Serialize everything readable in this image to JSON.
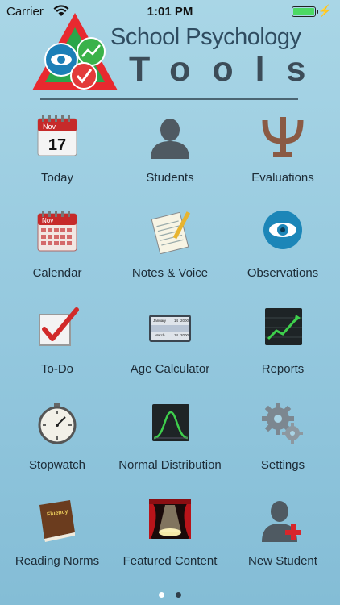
{
  "status_bar": {
    "carrier": "Carrier",
    "time": "1:01 PM",
    "battery_level": 1.0
  },
  "header": {
    "title_line1": "School Psychology",
    "title_line2": "Tools"
  },
  "apps": [
    {
      "label": "Today",
      "icon": "calendar-today-icon",
      "badge_month": "Nov",
      "badge_day": "17"
    },
    {
      "label": "Students",
      "icon": "person-silhouette-icon"
    },
    {
      "label": "Evaluations",
      "icon": "psi-symbol-icon"
    },
    {
      "label": "Calendar",
      "icon": "calendar-month-icon",
      "badge_month": "Nov"
    },
    {
      "label": "Notes & Voice",
      "icon": "notepad-pencil-icon"
    },
    {
      "label": "Observations",
      "icon": "eye-icon"
    },
    {
      "label": "To-Do",
      "icon": "checkbox-checked-icon"
    },
    {
      "label": "Age Calculator",
      "icon": "date-picker-icon",
      "picker_rows": [
        [
          "January",
          "14",
          "2000"
        ],
        [
          "March",
          "14",
          "2000"
        ]
      ]
    },
    {
      "label": "Reports",
      "icon": "line-chart-icon"
    },
    {
      "label": "Stopwatch",
      "icon": "stopwatch-icon"
    },
    {
      "label": "Normal Distribution",
      "icon": "bell-curve-icon"
    },
    {
      "label": "Settings",
      "icon": "gears-icon"
    },
    {
      "label": "Reading Norms",
      "icon": "fluency-book-icon",
      "book_text": "Fluency"
    },
    {
      "label": "Featured Content",
      "icon": "stage-curtain-icon"
    },
    {
      "label": "New Student",
      "icon": "add-person-icon"
    }
  ],
  "pagination": {
    "current_page": 1,
    "total_pages": 2
  },
  "colors": {
    "background_top": "#a9d6e6",
    "background_bottom": "#84bdd6",
    "label": "#1c2b36",
    "logo_text": "#2f4c60"
  }
}
